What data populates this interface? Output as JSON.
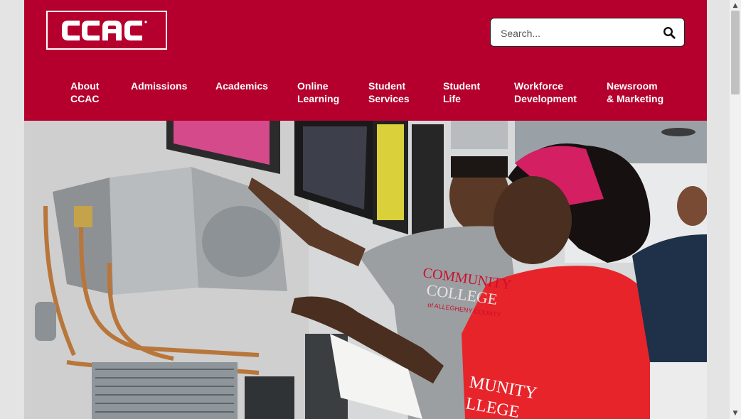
{
  "header": {
    "logo_text": "CCAC",
    "brand_color": "#b5002d"
  },
  "search": {
    "placeholder": "Search...",
    "icon": "search-icon"
  },
  "nav": {
    "items": [
      {
        "line1": "About",
        "line2": "CCAC"
      },
      {
        "line1": "Admissions",
        "line2": ""
      },
      {
        "line1": "Academics",
        "line2": ""
      },
      {
        "line1": "Online",
        "line2": "Learning"
      },
      {
        "line1": "Student",
        "line2": "Services"
      },
      {
        "line1": "Student",
        "line2": "Life"
      },
      {
        "line1": "Workforce",
        "line2": "Development"
      },
      {
        "line1": "Newsroom",
        "line2": "& Marketing"
      }
    ]
  },
  "hero": {
    "shirt_text_line1": "COMMUNITY",
    "shirt_text_line2": "COLLEGE",
    "shirt_text_line3": "of ALLEGHENY COUNTY",
    "shirt2_text_line1": "MUNITY",
    "shirt2_text_line2": "LLEGE"
  }
}
